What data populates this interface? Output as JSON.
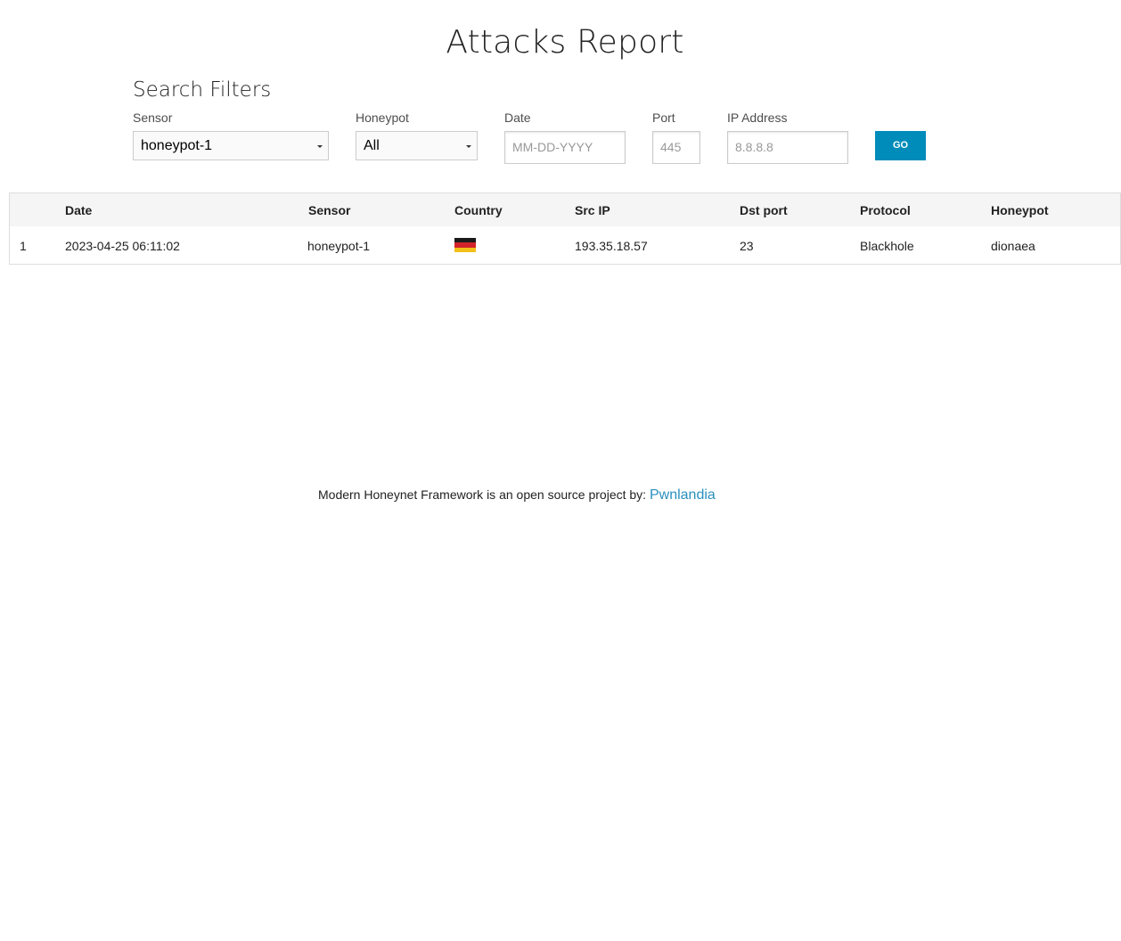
{
  "page": {
    "title": "Attacks Report"
  },
  "filters": {
    "heading": "Search Filters",
    "sensor": {
      "label": "Sensor",
      "value": "honeypot-1"
    },
    "honeypot": {
      "label": "Honeypot",
      "value": "All"
    },
    "date": {
      "label": "Date",
      "placeholder": "MM-DD-YYYY"
    },
    "port": {
      "label": "Port",
      "placeholder": "445"
    },
    "ip": {
      "label": "IP Address",
      "placeholder": "8.8.8.8"
    },
    "go_label": "GO",
    "go_color": "#008cba"
  },
  "table": {
    "headers": [
      "",
      "Date",
      "Sensor",
      "Country",
      "Src IP",
      "Dst port",
      "Protocol",
      "Honeypot"
    ],
    "rows": [
      {
        "index": "1",
        "date": "2023-04-25 06:11:02",
        "sensor": "honeypot-1",
        "country_flag": "germany-flag-icon",
        "src_ip": "193.35.18.57",
        "dst_port": "23",
        "protocol": "Blackhole",
        "honeypot": "dionaea"
      }
    ]
  },
  "footer": {
    "text": "Modern Honeynet Framework is an open source project by:",
    "link_label": "Pwnlandia",
    "link_color": "#2a8fbd"
  }
}
